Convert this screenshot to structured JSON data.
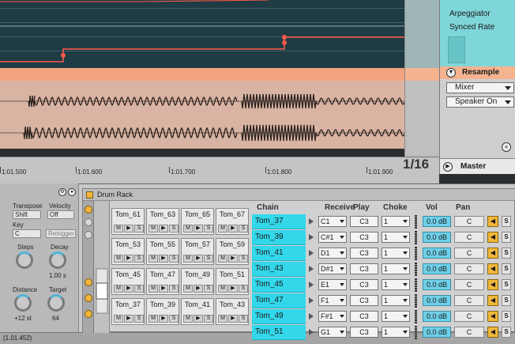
{
  "arrangement": {
    "ruler_labels": [
      "1:01.500",
      "1:01.600",
      "1:01.700",
      "1:01.800",
      "1:01.900"
    ],
    "page_counter": "1/16"
  },
  "io_panel": {
    "arpeggiator_label": "Arpeggiator",
    "synced_rate_label": "Synced Rate",
    "resample_label": "Resample",
    "mixer_label": "Mixer",
    "speaker_label": "Speaker On",
    "master_label": "Master"
  },
  "arp_device": {
    "transpose_label": "Transpose",
    "transpose_value": "Shift",
    "velocity_label": "Velocity",
    "velocity_value": "Off",
    "key_label": "Key",
    "key_value": "C",
    "retrigger_value": "Retrigger",
    "steps_label": "Steps",
    "decay_label": "Decay",
    "decay_value": "1.00 s",
    "distance_label": "Distance",
    "distance_value": "+12 st",
    "target_label": "Target",
    "target_value": "64",
    "status_text": "(1.01.452)"
  },
  "drum_rack": {
    "title": "Drum Rack",
    "pads": [
      [
        "Tom_61",
        "Tom_63",
        "Tom_65",
        "Tom_67"
      ],
      [
        "Tom_53",
        "Tom_55",
        "Tom_57",
        "Tom_59"
      ],
      [
        "Tom_45",
        "Tom_47",
        "Tom_49",
        "Tom_51"
      ],
      [
        "Tom_37",
        "Tom_39",
        "Tom_41",
        "Tom_43"
      ]
    ],
    "pad_buttons": [
      "M",
      "▶",
      "S"
    ],
    "headers": {
      "chain": "Chain",
      "receive": "Receive",
      "play": "Play",
      "choke": "Choke",
      "vol": "Vol",
      "pan": "Pan"
    },
    "chains": [
      {
        "name": "Tom_37",
        "receive": "C1",
        "play": "C3",
        "choke": "1",
        "vol": "0.0 dB",
        "pan": "C"
      },
      {
        "name": "Tom_39",
        "receive": "C#1",
        "play": "C3",
        "choke": "1",
        "vol": "0.0 dB",
        "pan": "C"
      },
      {
        "name": "Tom_41",
        "receive": "D1",
        "play": "C3",
        "choke": "1",
        "vol": "0.0 dB",
        "pan": "C"
      },
      {
        "name": "Tom_43",
        "receive": "D#1",
        "play": "C3",
        "choke": "1",
        "vol": "0.0 dB",
        "pan": "C"
      },
      {
        "name": "Tom_45",
        "receive": "E1",
        "play": "C3",
        "choke": "1",
        "vol": "0.0 dB",
        "pan": "C"
      },
      {
        "name": "Tom_47",
        "receive": "F1",
        "play": "C3",
        "choke": "1",
        "vol": "0.0 dB",
        "pan": "C"
      },
      {
        "name": "Tom_49",
        "receive": "F#1",
        "play": "C3",
        "choke": "1",
        "vol": "0.0 dB",
        "pan": "C"
      },
      {
        "name": "Tom_51",
        "receive": "G1",
        "play": "C3",
        "choke": "1",
        "vol": "0.0 dB",
        "pan": "C"
      }
    ],
    "solo_label": "S"
  },
  "colors": {
    "automation_bg": "#1f3b44",
    "automation_line": "#ff5a4a",
    "clip_bg": "#d9b4a2",
    "chain_cyan": "#33d7ea",
    "accent_orange": "#f2a380"
  }
}
